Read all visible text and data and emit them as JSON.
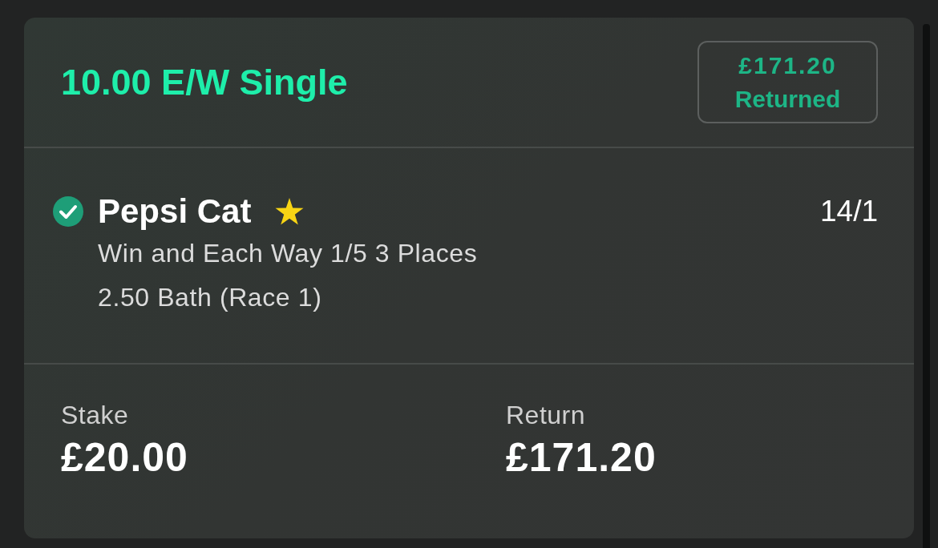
{
  "bet": {
    "title": "10.00 E/W Single",
    "badge": {
      "amount": "£171.20",
      "label": "Returned"
    }
  },
  "selection": {
    "won": true,
    "name": "Pepsi Cat",
    "starred": true,
    "odds": "14/1",
    "market": "Win and Each Way 1/5 3 Places",
    "event": "2.50 Bath (Race 1)"
  },
  "summary": [
    {
      "label": "Stake",
      "value": "£20.00"
    },
    {
      "label": "Return",
      "value": "£171.20"
    }
  ]
}
